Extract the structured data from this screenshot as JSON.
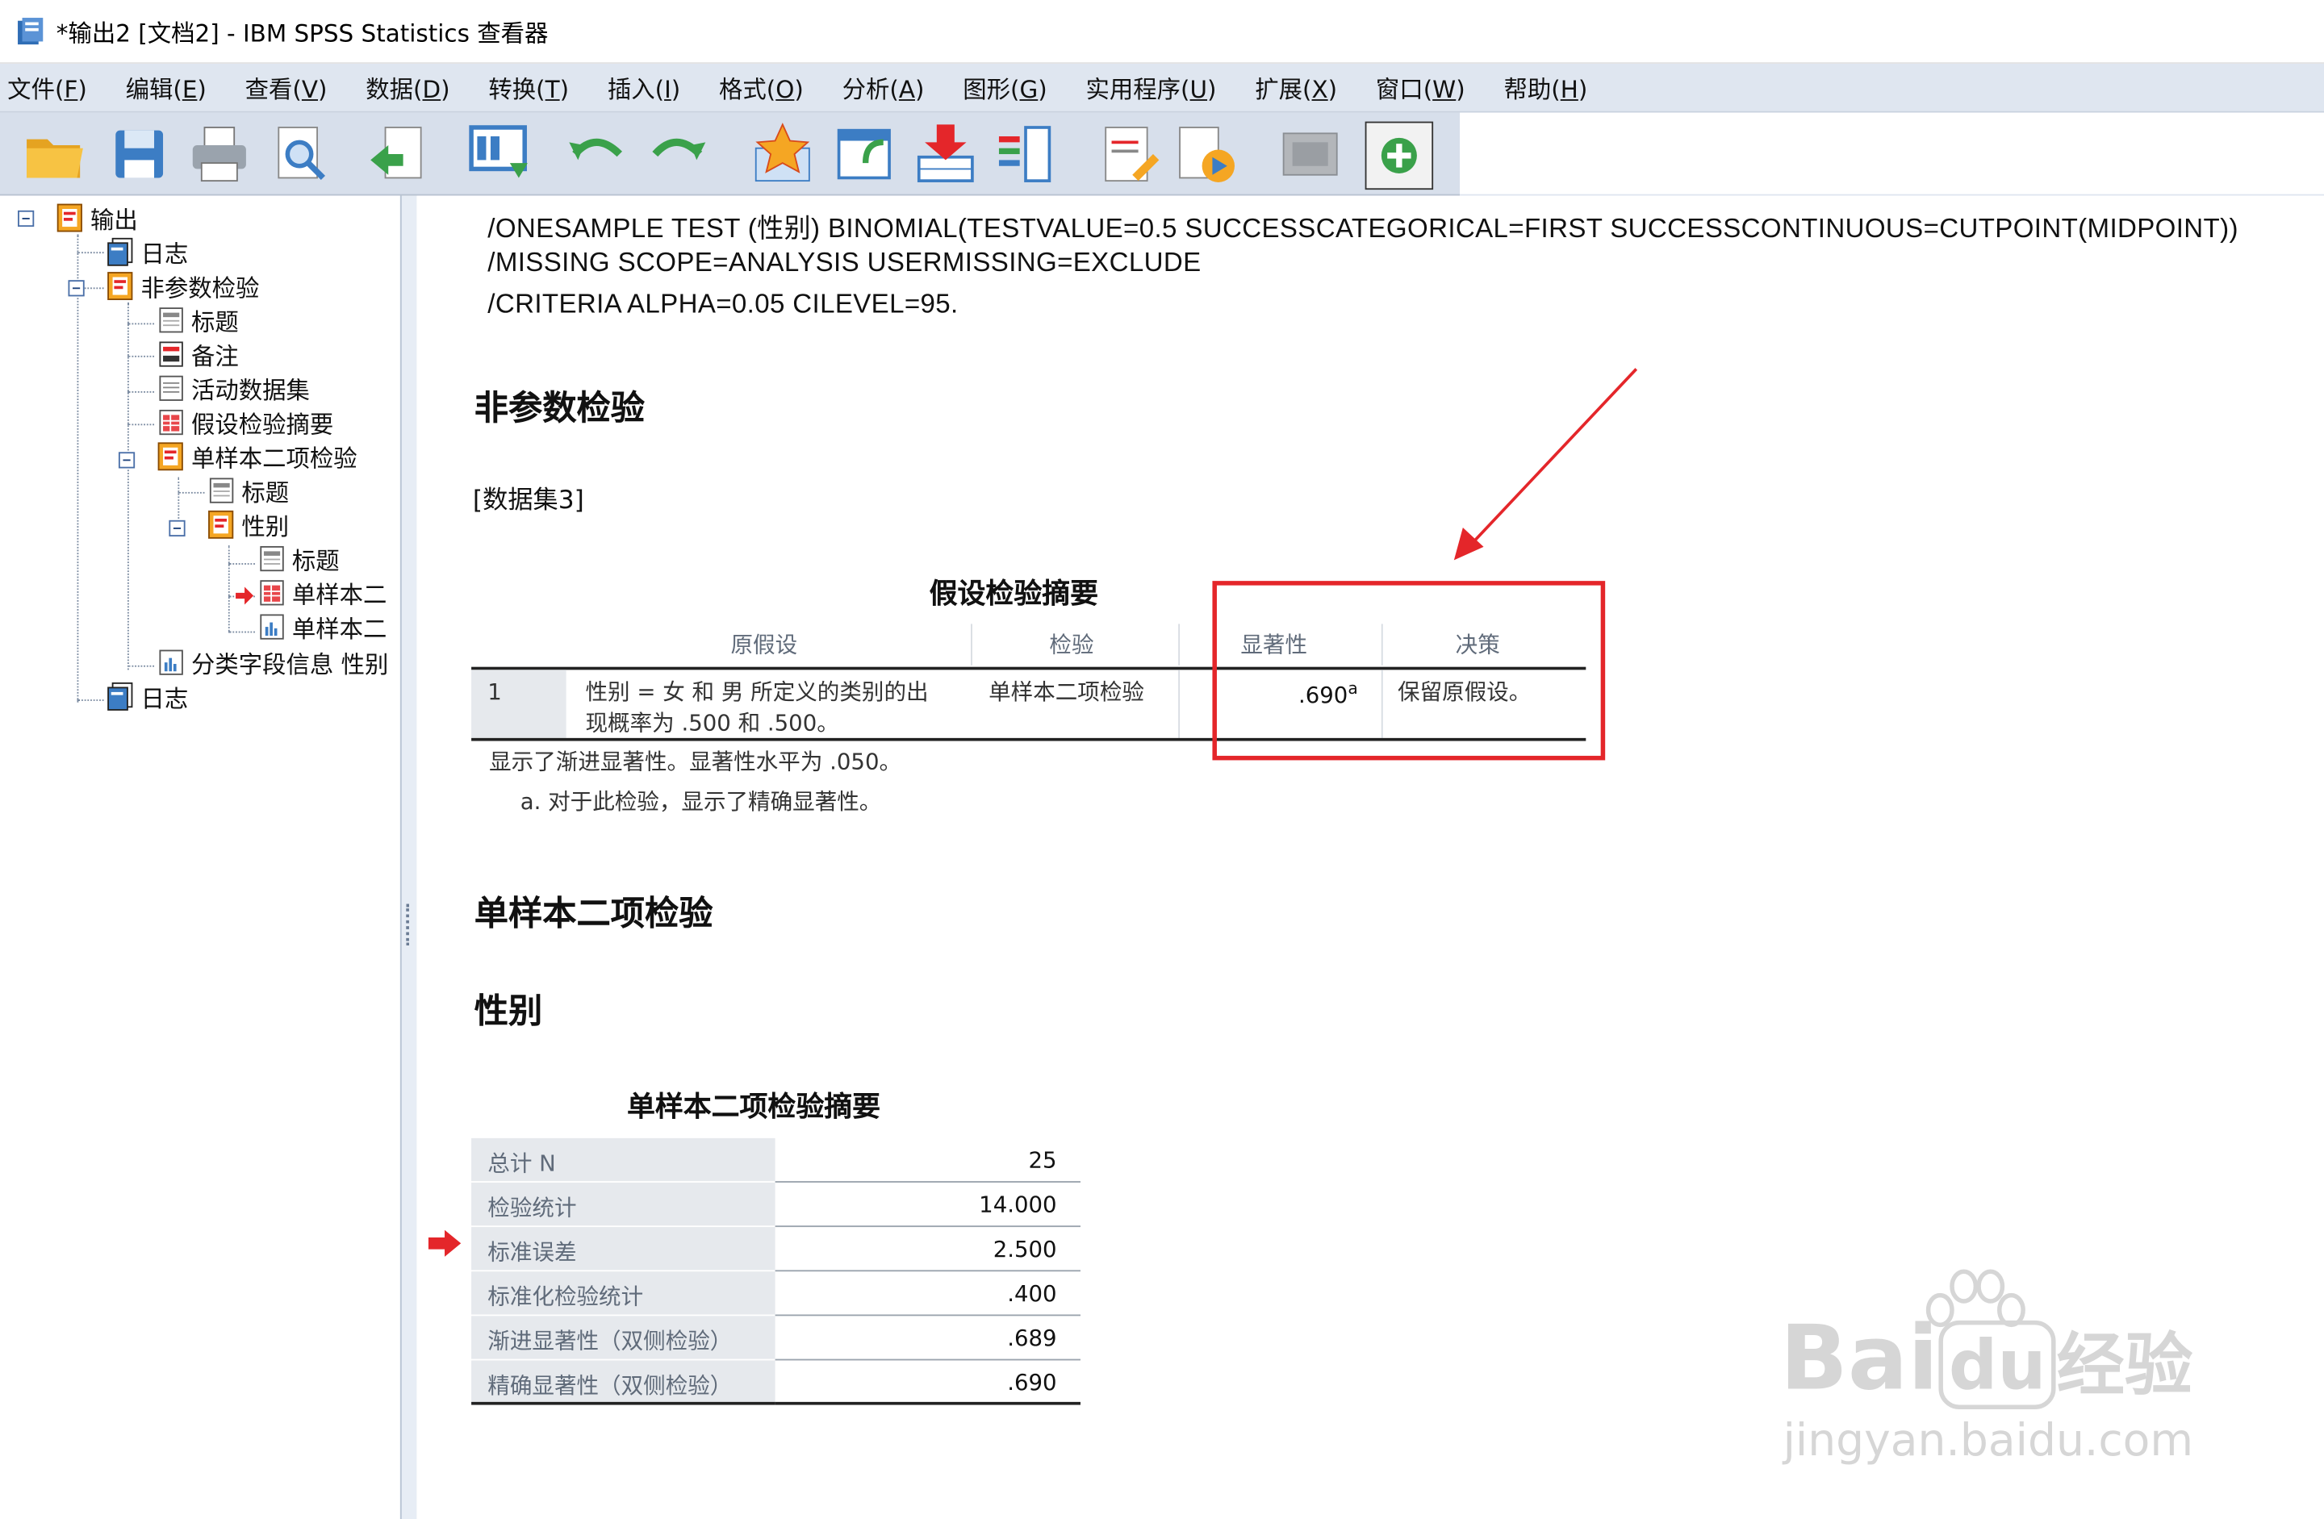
{
  "window": {
    "title": "*输出2 [文档2] - IBM SPSS Statistics 查看器"
  },
  "menu": [
    {
      "label": "文件(",
      "key": "F",
      "tail": ")"
    },
    {
      "label": "编辑(",
      "key": "E",
      "tail": ")"
    },
    {
      "label": "查看(",
      "key": "V",
      "tail": ")"
    },
    {
      "label": "数据(",
      "key": "D",
      "tail": ")"
    },
    {
      "label": "转换(",
      "key": "T",
      "tail": ")"
    },
    {
      "label": "插入(",
      "key": "I",
      "tail": ")"
    },
    {
      "label": "格式(",
      "key": "O",
      "tail": ")"
    },
    {
      "label": "分析(",
      "key": "A",
      "tail": ")"
    },
    {
      "label": "图形(",
      "key": "G",
      "tail": ")"
    },
    {
      "label": "实用程序(",
      "key": "U",
      "tail": ")"
    },
    {
      "label": "扩展(",
      "key": "X",
      "tail": ")"
    },
    {
      "label": "窗口(",
      "key": "W",
      "tail": ")"
    },
    {
      "label": "帮助(",
      "key": "H",
      "tail": ")"
    }
  ],
  "toolbar": {
    "icons": [
      "open-icon",
      "save-icon",
      "print-icon",
      "print-preview-icon",
      "export-icon",
      "go-to-data-icon",
      "undo-icon",
      "redo-icon",
      "favorites-icon",
      "recall-dialog-icon",
      "go-to-case-icon",
      "variables-icon",
      "edit-syntax-icon",
      "run-script-icon",
      "hide-icon",
      "designate-window-icon"
    ]
  },
  "outline": {
    "nodes": [
      {
        "label": "输出",
        "icon": "output-book-icon"
      },
      {
        "label": "日志",
        "icon": "log-icon"
      },
      {
        "label": "非参数检验",
        "icon": "output-book-icon"
      },
      {
        "label": "标题",
        "icon": "title-icon"
      },
      {
        "label": "备注",
        "icon": "notes-icon"
      },
      {
        "label": "活动数据集",
        "icon": "dataset-icon"
      },
      {
        "label": "假设检验摘要",
        "icon": "table-icon"
      },
      {
        "label": "单样本二项检验",
        "icon": "output-book-icon"
      },
      {
        "label": "标题",
        "icon": "title-icon"
      },
      {
        "label": "性别",
        "icon": "output-book-icon"
      },
      {
        "label": "标题",
        "icon": "title-icon"
      },
      {
        "label": "单样本二",
        "icon": "table-icon"
      },
      {
        "label": "单样本二",
        "icon": "chart-icon"
      },
      {
        "label": "分类字段信息 性别",
        "icon": "chart-icon"
      },
      {
        "label": "日志",
        "icon": "log-icon"
      }
    ]
  },
  "syntax": [
    "/ONESAMPLE TEST (性别) BINOMIAL(TESTVALUE=0.5 SUCCESSCATEGORICAL=FIRST SUCCESSCONTINUOUS=CUTPOINT(MIDPOINT))",
    "/MISSING SCOPE=ANALYSIS USERMISSING=EXCLUDE",
    "/CRITERIA ALPHA=0.05 CILEVEL=95."
  ],
  "headings": {
    "nonparam": "非参数检验",
    "dataset": "[数据集3]",
    "binomial": "单样本二项检验",
    "gender": "性别"
  },
  "hypothesis_table": {
    "title": "假设检验摘要",
    "columns": [
      "原假设",
      "检验",
      "显著性",
      "决策"
    ],
    "row": {
      "index": "1",
      "null_hypothesis_line1": "性别 = 女 和 男 所定义的类别的出",
      "null_hypothesis_line2": "现概率为 .500 和 .500。",
      "test": "单样本二项检验",
      "significance": ".690",
      "significance_sup": "a",
      "decision": "保留原假设。"
    },
    "footnote1": "显示了渐进显著性。显著性水平为 .050。",
    "footnote2": "a. 对于此检验，显示了精确显著性。"
  },
  "binomial_table": {
    "title": "单样本二项检验摘要",
    "rows": [
      {
        "label": "总计 N",
        "value": "25"
      },
      {
        "label": "检验统计",
        "value": "14.000"
      },
      {
        "label": "标准误差",
        "value": "2.500"
      },
      {
        "label": "标准化检验统计",
        "value": ".400"
      },
      {
        "label": "渐进显著性（双侧检验）",
        "value": ".689"
      },
      {
        "label": "精确显著性（双侧检验）",
        "value": ".690"
      }
    ]
  },
  "watermark": {
    "brand": "Bai",
    "du": "du",
    "suffix": "经验",
    "url": "jingyan.baidu.com"
  },
  "colors": {
    "accent_red": "#e4262a",
    "menu_bg": "#dfe6f0",
    "toolbar_bg": "#d7dfeb",
    "table_label_bg": "#e6e9ed"
  }
}
